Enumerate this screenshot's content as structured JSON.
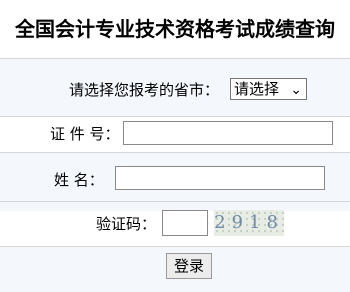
{
  "title": "全国会计专业技术资格考试成绩查询",
  "form": {
    "province_label": "请选择您报考的省市：",
    "province_selected": "请选择",
    "id_label": "证 件 号：",
    "id_value": "",
    "name_label": "姓   名：",
    "name_value": "",
    "captcha_label": "验证码：",
    "captcha_value": "",
    "captcha_text": "2918",
    "submit_label": "登录"
  },
  "icons": {
    "dropdown": "chevron-down-icon"
  }
}
